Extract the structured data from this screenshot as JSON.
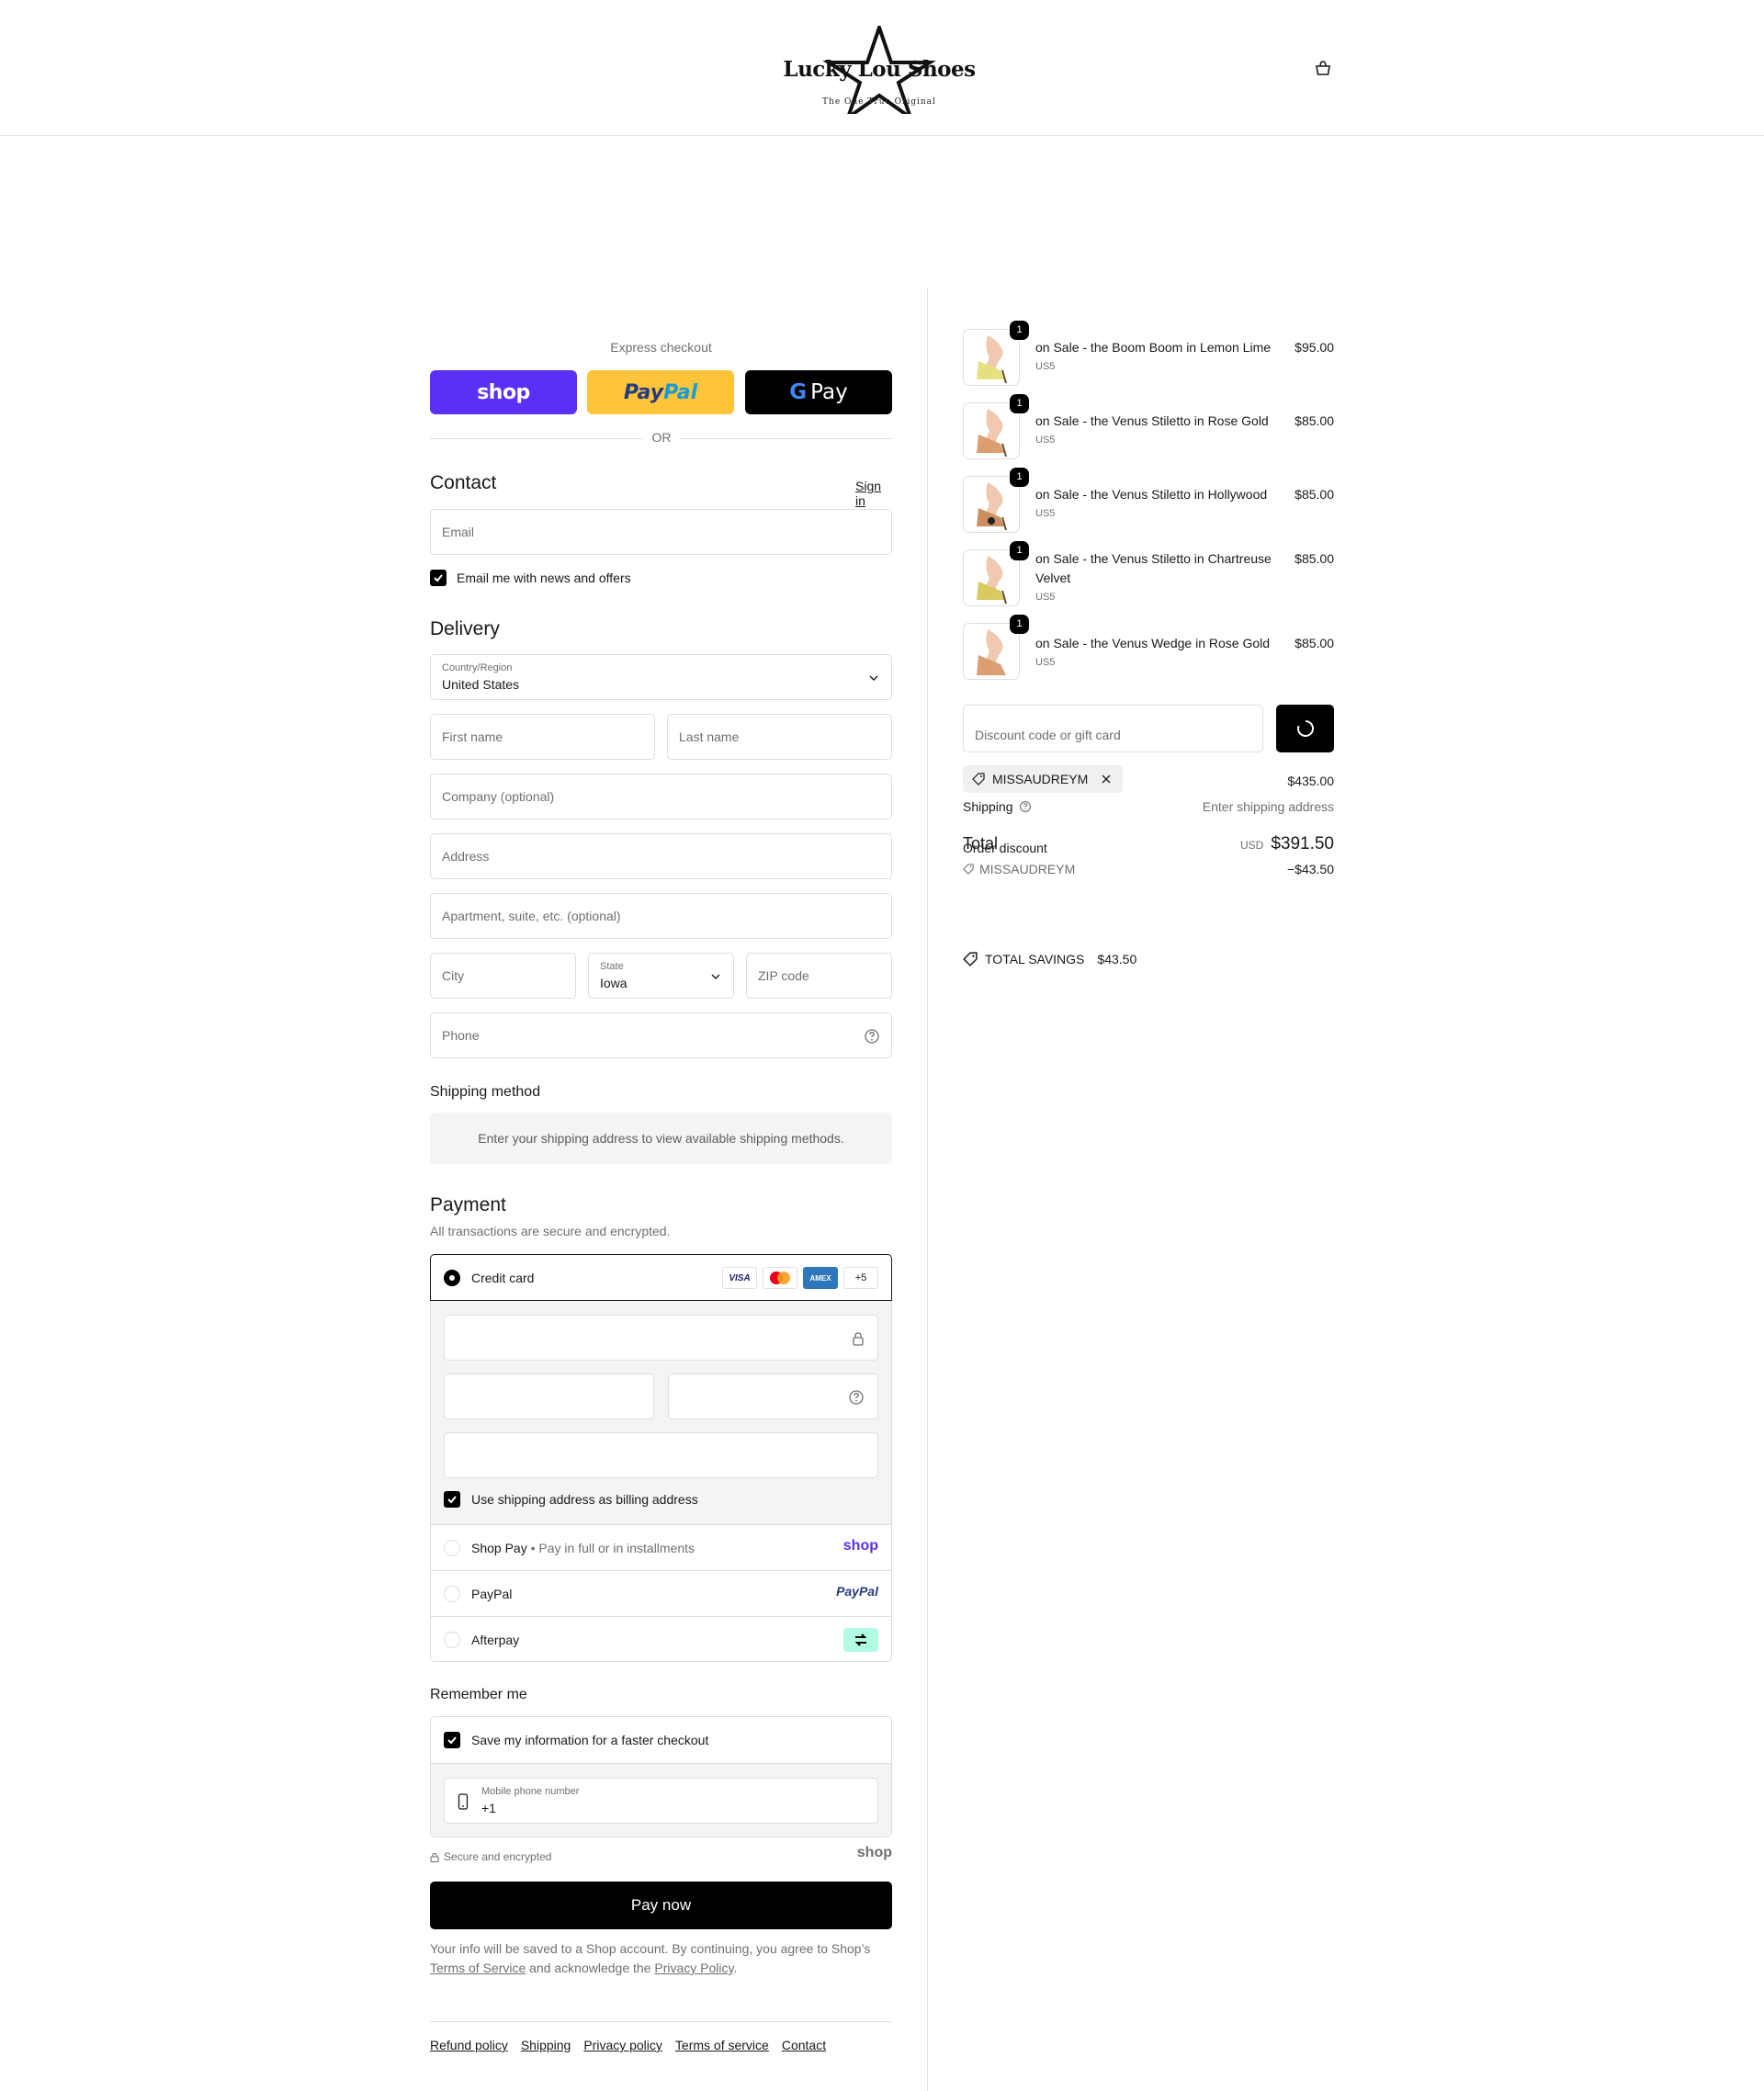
{
  "header": {
    "logo_text": "Lucky Lou Shoes",
    "logo_tagline": "The One True Original",
    "cart_icon": "bag-icon"
  },
  "express": {
    "label": "Express checkout",
    "shop_label": "shop",
    "paypal_label_a": "Pay",
    "paypal_label_b": "Pal",
    "gpay_label_g": "G",
    "gpay_label": "Pay",
    "or": "OR"
  },
  "contact": {
    "title": "Contact",
    "sign_in": "Sign in",
    "email_placeholder": "Email",
    "news_label": "Email me with news and offers"
  },
  "delivery": {
    "title": "Delivery",
    "country_label": "Country/Region",
    "country_value": "United States",
    "first_name": "First name",
    "last_name": "Last name",
    "company": "Company (optional)",
    "address": "Address",
    "apartment": "Apartment, suite, etc. (optional)",
    "city": "City",
    "state_label": "State",
    "state_value": "Iowa",
    "zip": "ZIP code",
    "phone": "Phone"
  },
  "shipping_method": {
    "title": "Shipping method",
    "message": "Enter your shipping address to view available shipping methods."
  },
  "payment": {
    "title": "Payment",
    "subtitle": "All transactions are secure and encrypted.",
    "credit_card": "Credit card",
    "card_logos": [
      "VISA",
      "",
      "AMEX",
      "+5"
    ],
    "billing_same": "Use shipping address as billing address",
    "shop_pay": "Shop Pay",
    "shop_pay_sub": "Pay in full or in installments",
    "shop_pay_brand": "shop",
    "paypal": "PayPal",
    "paypal_brand": "PayPal",
    "afterpay": "Afterpay"
  },
  "remember": {
    "title": "Remember me",
    "save_label": "Save my information for a faster checkout",
    "phone_label": "Mobile phone number",
    "phone_value": "+1",
    "secure": "Secure and encrypted",
    "shop_brand": "shop"
  },
  "pay_now": "Pay now",
  "legal": {
    "text_a": "Your info will be saved to a Shop account. By continuing, you agree to Shop’s ",
    "tos": "Terms of Service",
    "text_b": " and acknowledge the ",
    "privacy": "Privacy Policy",
    "text_c": "."
  },
  "footer": [
    "Refund policy",
    "Shipping",
    "Privacy policy",
    "Terms of service",
    "Contact"
  ],
  "cart": {
    "items": [
      {
        "name": "on Sale - the Boom Boom in Lemon Lime",
        "sub": "US5",
        "price": "$95.00",
        "qty": "1",
        "color": "#e6e07a"
      },
      {
        "name": "on Sale - the Venus Stiletto in Rose Gold",
        "sub": "US5",
        "price": "$85.00",
        "qty": "1",
        "color": "#d99a6c"
      },
      {
        "name": "on Sale - the Venus Stiletto in Hollywood",
        "sub": "US5",
        "price": "$85.00",
        "qty": "1",
        "color": "#c98a5a"
      },
      {
        "name": "on Sale - the Venus Stiletto in Chartreuse Velvet",
        "sub": "US5",
        "price": "$85.00",
        "qty": "1",
        "color": "#d6c85a"
      },
      {
        "name": "on Sale - the Venus Wedge in Rose Gold",
        "sub": "US5",
        "price": "$85.00",
        "qty": "1",
        "color": "#d99a6c"
      }
    ],
    "discount_placeholder": "Discount code or gift card",
    "code": "MISSAUDREYM",
    "subtotal": "$435.00",
    "shipping_label": "Shipping",
    "shipping_value": "Enter shipping address",
    "total_label": "Total",
    "order_discount_label": "Order discount",
    "currency": "USD",
    "total": "$391.50",
    "discount_code": "MISSAUDREYM",
    "discount_amount": "−$43.50",
    "savings_label": "TOTAL SAVINGS",
    "savings_amount": "$43.50"
  }
}
